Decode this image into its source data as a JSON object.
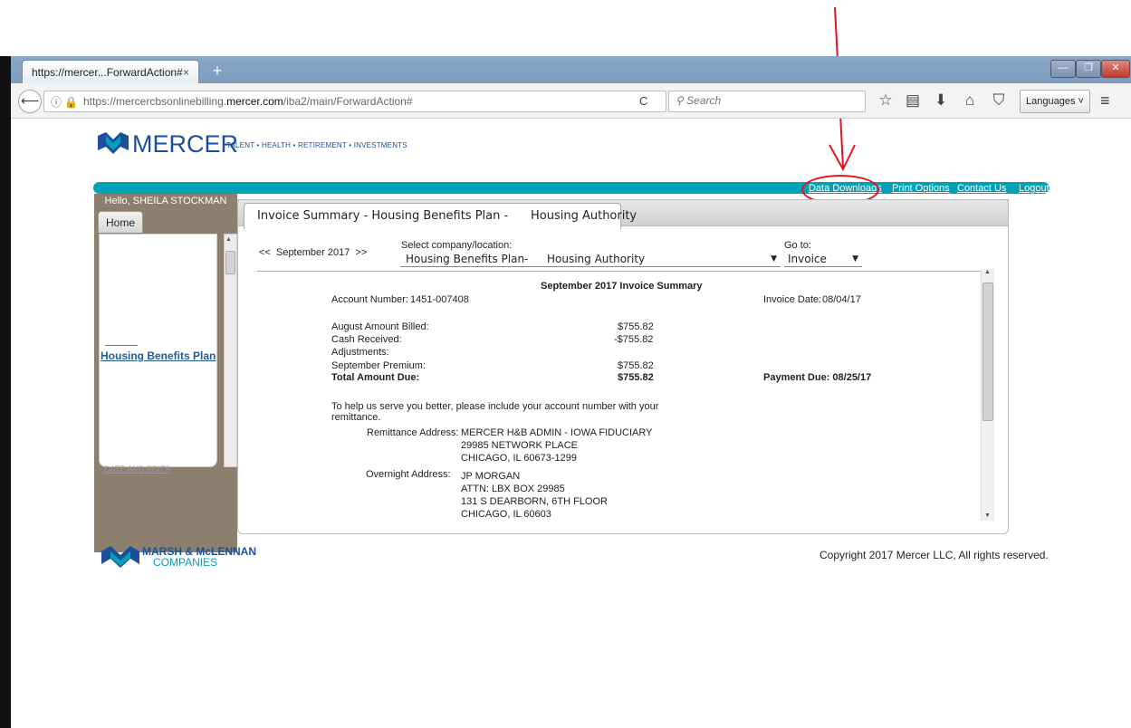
{
  "browser": {
    "tab_title": "https://mercer...ForwardAction#",
    "tab_close": "×",
    "new_tab": "+",
    "url_domain_pre": "https://mercercbsonlinebilling.",
    "url_domain_bold": "mercer.com",
    "url_path": "/iba2/main/ForwardAction#",
    "search_placeholder": "Search",
    "languages_label": "Languages ˅"
  },
  "header": {
    "brand": "MERCER",
    "tagline": "TALENT • HEALTH • RETIREMENT • INVESTMENTS",
    "links": [
      "Data Downloads",
      "Print Options",
      "Contact Us",
      "Logout"
    ]
  },
  "sidebar": {
    "greeting": "Hello, SHEILA STOCKMAN",
    "home_tab": "Home",
    "plan_link": "Housing Benefits Plan",
    "cut_link": "DATE AND EDITS"
  },
  "content": {
    "tab_title": "Invoice Summary - Housing Benefits Plan -      Housing Authority",
    "month_prev": "<<",
    "month": "September 2017",
    "month_next": ">>",
    "select_company_label": "Select company/location:",
    "company_value_1": "Housing Benefits Plan-",
    "company_value_2": "Housing Authority",
    "goto_label": "Go to:",
    "goto_value": "Invoice",
    "summary_title": "September 2017 Invoice Summary",
    "account_label": "Account Number:",
    "account_number": "1451-007408",
    "invoice_date_label": "Invoice Date:",
    "invoice_date": "08/04/17",
    "lines": [
      {
        "label": "August Amount Billed:",
        "amount": "$755.82"
      },
      {
        "label": "Cash Received:",
        "amount": "-$755.82"
      },
      {
        "label": "Adjustments:",
        "amount": ""
      },
      {
        "label": "September Premium:",
        "amount": "$755.82"
      }
    ],
    "total_label": "Total Amount Due:",
    "total_amount": "$755.82",
    "payment_due": "Payment Due: 08/25/17",
    "help_text_1": "To help us serve you better, please include your account number with your",
    "help_text_2": "remittance.",
    "remittance_label": "Remittance Address:",
    "remittance_lines": [
      "MERCER H&B ADMIN - IOWA FIDUCIARY",
      "29985 NETWORK PLACE",
      "CHICAGO, IL 60673-1299"
    ],
    "overnight_label": "Overnight Address:",
    "overnight_lines": [
      "JP MORGAN",
      "ATTN: LBX BOX 29985",
      "131 S DEARBORN, 6TH FLOOR",
      "CHICAGO, IL 60603"
    ]
  },
  "footer": {
    "mmc_line1": "MARSH & McLENNAN",
    "mmc_line2": "COMPANIES",
    "copyright": "Copyright 2017 Mercer LLC, All rights reserved."
  },
  "colors": {
    "teal": "#00a2b8",
    "brand_blue": "#1b4f9c",
    "annotation_red": "#e0141e"
  }
}
